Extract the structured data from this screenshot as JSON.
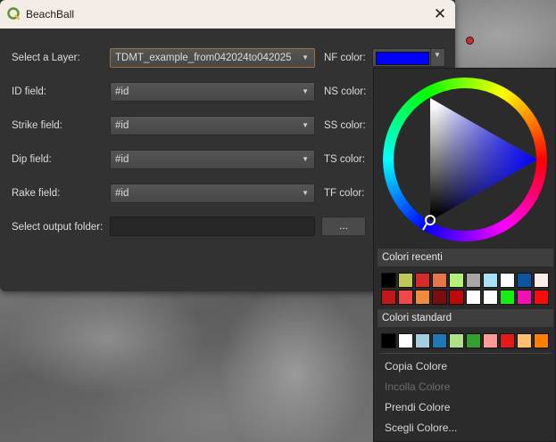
{
  "window": {
    "title": "BeachBall",
    "close_glyph": "✕"
  },
  "form": {
    "layer": {
      "label": "Select a Layer:",
      "value": "TDMT_example_from042024to042025"
    },
    "id": {
      "label": "ID field:",
      "value": "#id"
    },
    "strike": {
      "label": "Strike field:",
      "value": "#id"
    },
    "dip": {
      "label": "Dip field:",
      "value": "#id"
    },
    "rake": {
      "label": "Rake field:",
      "value": "#id"
    },
    "output": {
      "label": "Select output folder:",
      "value": "",
      "browse_label": "..."
    }
  },
  "colors": {
    "nf_label": "NF color:",
    "ns_label": "NS color:",
    "ss_label": "SS color:",
    "ts_label": "TS color:",
    "tf_label": "TF color:",
    "nf_value": "#0000ff"
  },
  "popup": {
    "recent_title": "Colori recenti",
    "standard_title": "Colori standard",
    "recent_colors": [
      "#000000",
      "#c0c853",
      "#d42a2a",
      "#e4764a",
      "#b5f07a",
      "#a6a6a6",
      "#a6e2f5",
      "#ffffff",
      "#0d55a0",
      "#fbeee8",
      "#c01818",
      "#f04848",
      "#f08a3c",
      "#7a0d0d",
      "#c00808",
      "#ffffff",
      "#ffffff",
      "#11f011",
      "#f011b0",
      "#ff0a0a"
    ],
    "standard_colors": [
      "#000000",
      "#ffffff",
      "#a6cee3",
      "#1f78b4",
      "#b2df8a",
      "#33a02c",
      "#fb9a99",
      "#e31a1c",
      "#fdbf6f",
      "#ff7f00"
    ],
    "copy_label": "Copia Colore",
    "paste_label": "Incolla Colore",
    "pick_label": "Prendi Colore",
    "choose_label": "Scegli Colore..."
  }
}
